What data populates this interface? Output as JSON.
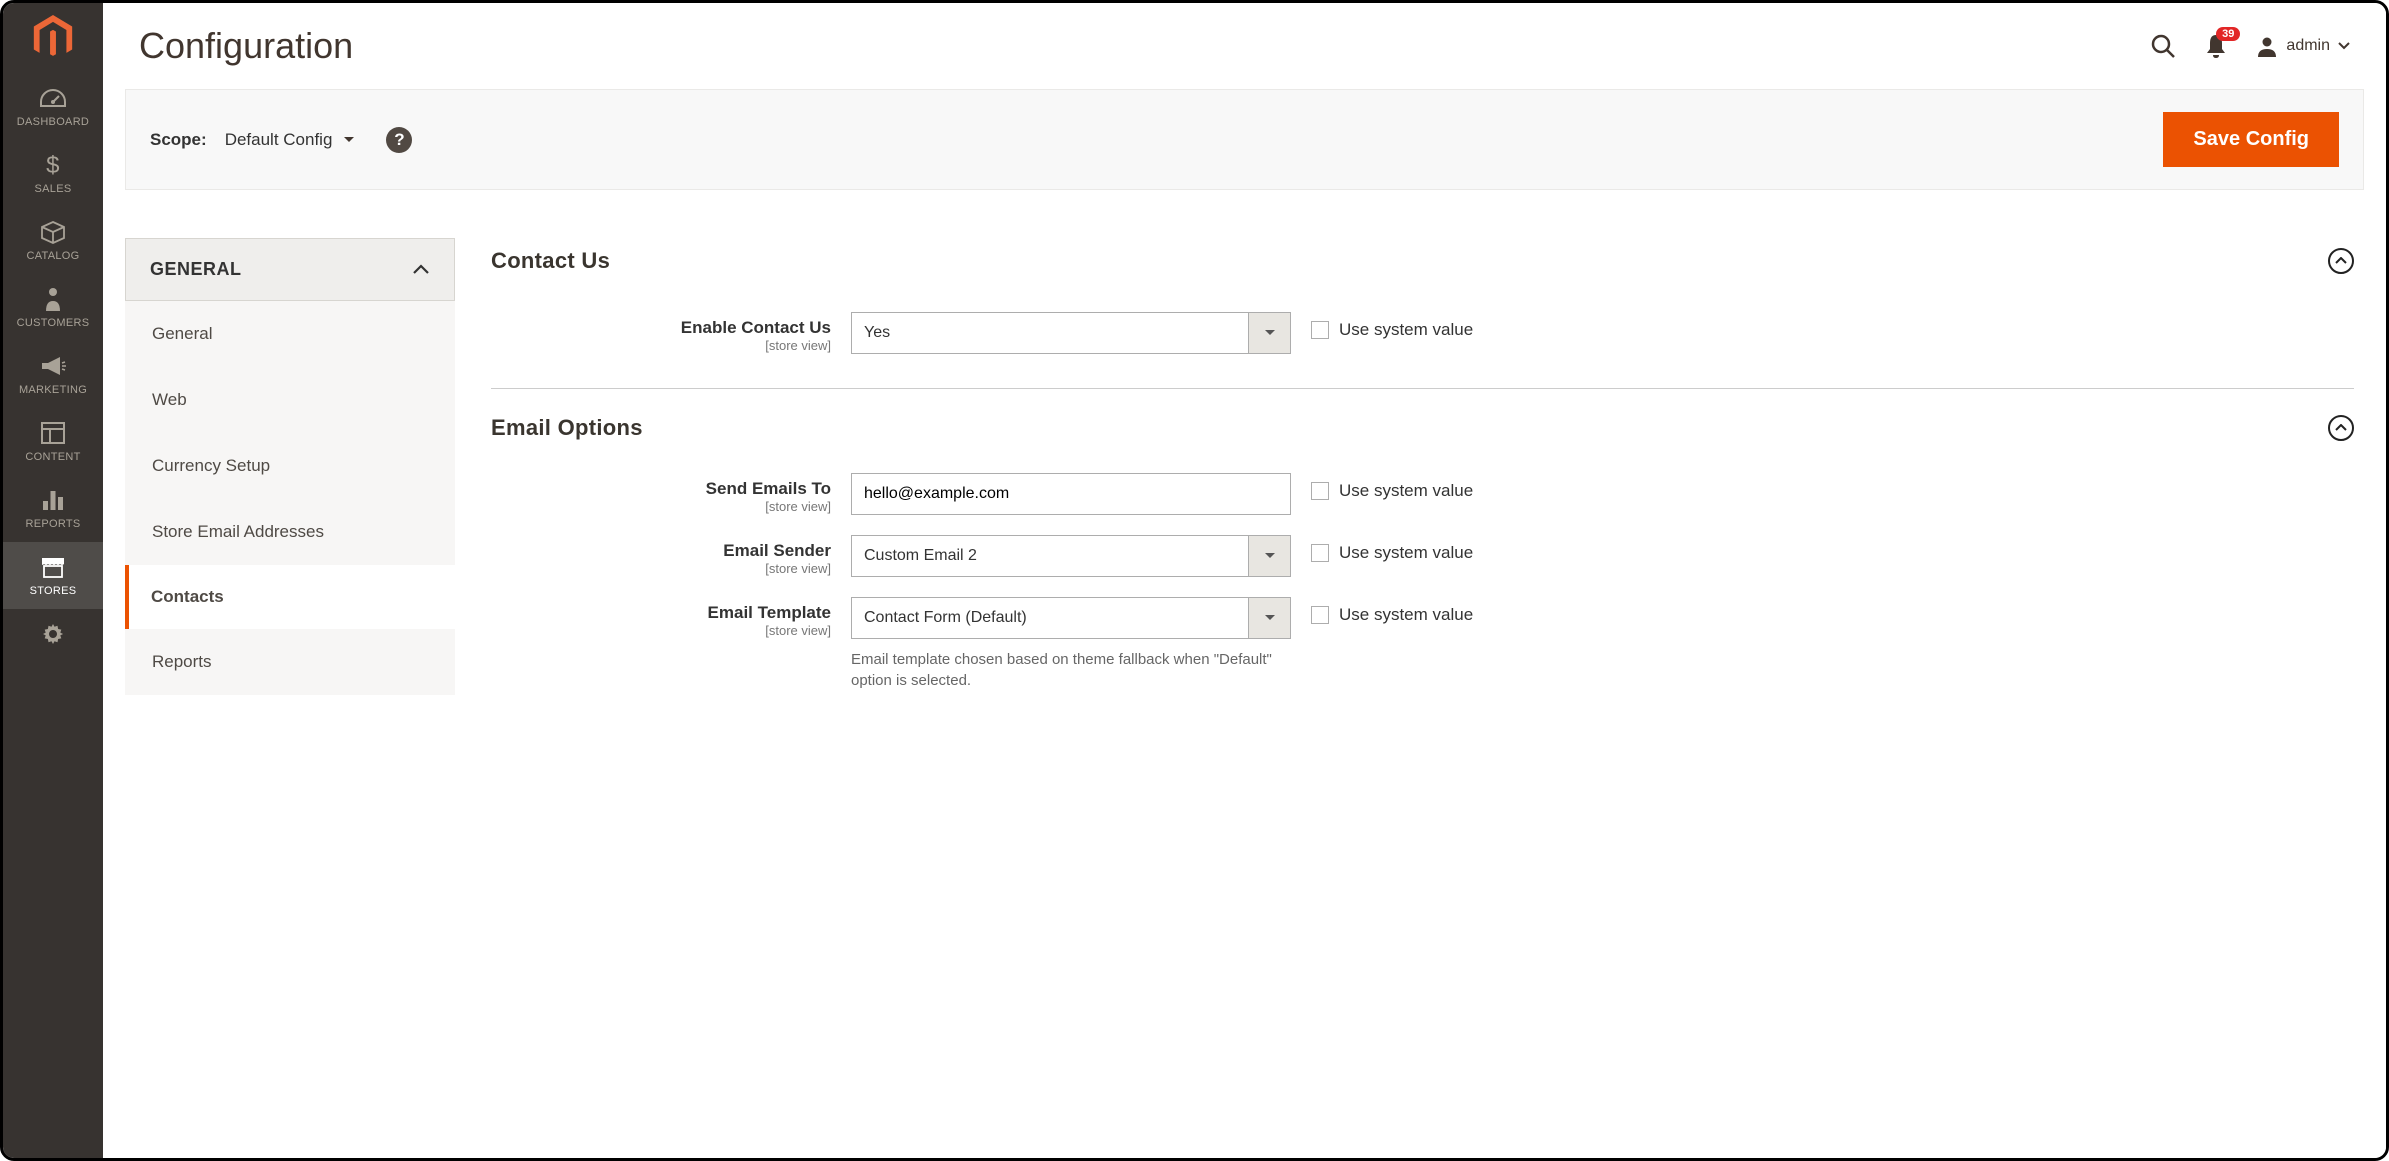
{
  "page": {
    "title": "Configuration"
  },
  "header": {
    "notification_count": "39",
    "user_label": "admin"
  },
  "toolbar": {
    "scope_label": "Scope:",
    "scope_value": "Default Config",
    "save_label": "Save Config"
  },
  "config_nav": {
    "group_title": "GENERAL",
    "items": [
      {
        "label": "General"
      },
      {
        "label": "Web"
      },
      {
        "label": "Currency Setup"
      },
      {
        "label": "Store Email Addresses"
      },
      {
        "label": "Contacts"
      },
      {
        "label": "Reports"
      }
    ]
  },
  "sections": {
    "contact_us": {
      "title": "Contact Us",
      "fields": {
        "enable": {
          "label": "Enable Contact Us",
          "scope": "[store view]",
          "value": "Yes",
          "system_label": "Use system value"
        }
      }
    },
    "email_options": {
      "title": "Email Options",
      "fields": {
        "send_to": {
          "label": "Send Emails To",
          "scope": "[store view]",
          "value": "hello@example.com",
          "system_label": "Use system value"
        },
        "sender": {
          "label": "Email Sender",
          "scope": "[store view]",
          "value": "Custom Email 2",
          "system_label": "Use system value"
        },
        "template": {
          "label": "Email Template",
          "scope": "[store view]",
          "value": "Contact Form (Default)",
          "system_label": "Use system value",
          "help": "Email template chosen based on theme fallback when \"Default\" option is selected."
        }
      }
    }
  },
  "sidebar": {
    "items": [
      {
        "label": "DASHBOARD"
      },
      {
        "label": "SALES"
      },
      {
        "label": "CATALOG"
      },
      {
        "label": "CUSTOMERS"
      },
      {
        "label": "MARKETING"
      },
      {
        "label": "CONTENT"
      },
      {
        "label": "REPORTS"
      },
      {
        "label": "STORES"
      }
    ]
  }
}
